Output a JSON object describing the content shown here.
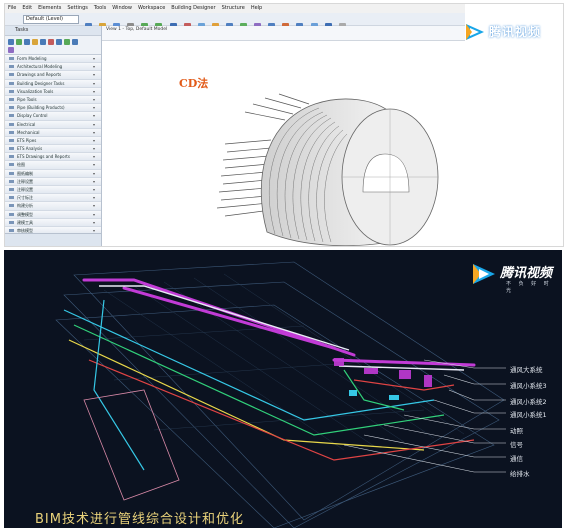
{
  "shot1": {
    "menu": [
      "File",
      "Edit",
      "Elements",
      "Settings",
      "Tools",
      "Window",
      "Workspace",
      "Building Designer",
      "Structure",
      "Help"
    ],
    "toolbar_combo": "Default (Level)",
    "sidebar": {
      "header": "Tasks",
      "items": [
        "Form Modeling",
        "Architectural Modeling",
        "Drawings and Reports",
        "Building Designer Tasks",
        "Visualization Tools",
        "Pipe Tools",
        "Pipe (Building Products)",
        "Display Control",
        "Electrical",
        "Mechanical",
        "ETS Pipes",
        "ETS Analysis",
        "ETS Drawings and Reports",
        "绘图",
        "图纸编制",
        "注释设置",
        "注释设置",
        "尺寸标注",
        "构建分析",
        "调整模型",
        "建模工具",
        "审核模型"
      ]
    },
    "viewport_title": "View 1 - Top, Default Model",
    "annotation": "CD法",
    "logo": {
      "name": "腾讯视频"
    }
  },
  "shot2": {
    "logo": {
      "name": "腾讯视频",
      "slogan": "不 负 好 时 光"
    },
    "legend": [
      "通风大系统",
      "通风小系统3",
      "通风小系统2",
      "通风小系统1",
      "动照",
      "信号",
      "通信",
      "给排水"
    ],
    "caption": "BIM技术进行管线综合设计和优化"
  },
  "colors": {
    "accent_orange": "#e25a18",
    "bim_bg": "#0b1220",
    "caption_gold": "#e9d27a",
    "pipe_magenta": "#c23bd6",
    "pipe_cyan": "#36c8e6"
  }
}
